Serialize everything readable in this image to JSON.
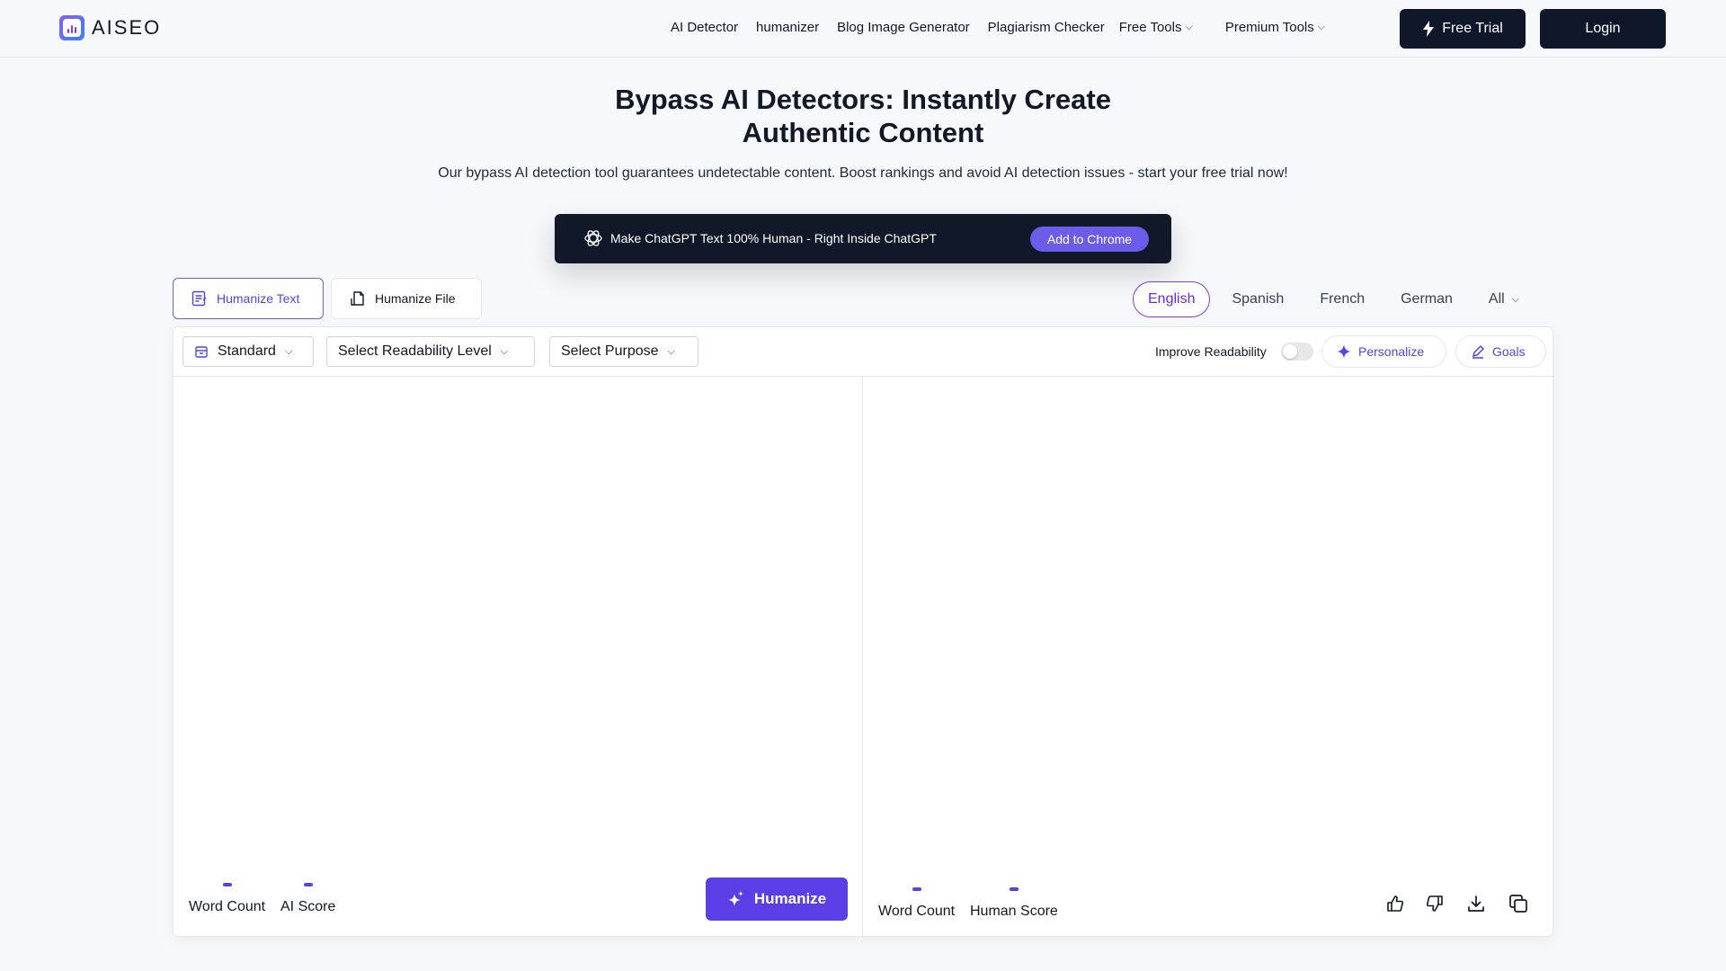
{
  "brand": {
    "name": "AISEO"
  },
  "nav": {
    "links": [
      "AI Detector",
      "humanizer",
      "Blog Image Generator",
      "Plagiarism Checker"
    ],
    "free_tools": "Free Tools",
    "premium_tools": "Premium Tools",
    "free_trial": "Free Trial",
    "login": "Login"
  },
  "hero": {
    "title_line1": "Bypass AI Detectors: Instantly Create",
    "title_line2": "Authentic Content",
    "subtitle": "Our bypass AI detection tool guarantees undetectable content. Boost rankings and avoid AI detection issues - start your free trial now!"
  },
  "promo": {
    "text": "Make ChatGPT Text 100% Human - Right Inside ChatGPT",
    "button": "Add to Chrome"
  },
  "tabs": {
    "humanize_text": "Humanize Text",
    "humanize_file": "Humanize File"
  },
  "languages": {
    "items": [
      "English",
      "Spanish",
      "French",
      "German"
    ],
    "all": "All",
    "active": "English"
  },
  "toolbar": {
    "mode": "Standard",
    "readability": "Select Readability Level",
    "purpose": "Select Purpose",
    "improve_readability": "Improve Readability",
    "improve_readability_on": false,
    "personalize": "Personalize",
    "goals": "Goals"
  },
  "input_pane": {
    "word_count": "Word Count",
    "ai_score": "AI Score",
    "humanize": "Humanize"
  },
  "output_pane": {
    "word_count": "Word Count",
    "human_score": "Human Score"
  },
  "colors": {
    "accent": "#5b3ee6",
    "dark": "#0f172a",
    "promo_button": "#6d5ce8"
  },
  "icons": {
    "logo": "aiseo-logo-icon",
    "trial": "lightning-icon",
    "promo": "openai-icon",
    "humanize_text": "text-edit-icon",
    "humanize_file": "file-icon",
    "standard": "box-icon",
    "personalize": "sparkle-icon",
    "goals": "pencil-icon",
    "humanize": "sparkles-icon",
    "feedback": [
      "thumbs-up-icon",
      "thumbs-down-icon",
      "download-icon",
      "copy-icon"
    ]
  }
}
